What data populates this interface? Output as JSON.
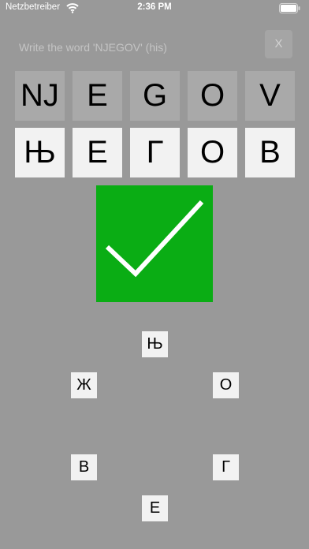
{
  "status_bar": {
    "carrier": "Netzbetreiber",
    "time": "2:36 PM"
  },
  "exercise": {
    "prompt": "Write the word 'NJEGOV' (his)",
    "close_label": "X",
    "latin_letters": [
      "NJ",
      "E",
      "G",
      "O",
      "V"
    ],
    "cyrillic_letters": [
      "Њ",
      "Е",
      "Г",
      "О",
      "В"
    ]
  },
  "result": {
    "state": "correct",
    "icon": "checkmark-icon",
    "color": "#0aad14"
  },
  "choices": [
    "Њ",
    "Ж",
    "О",
    "В",
    "Г",
    "Е"
  ],
  "colors": {
    "background": "#999999",
    "latin_tile": "#a9a9a9",
    "cyrillic_tile": "#f2f2f2",
    "choice_tile": "#f2f2f2",
    "prompt_text": "#c4c4c4"
  }
}
